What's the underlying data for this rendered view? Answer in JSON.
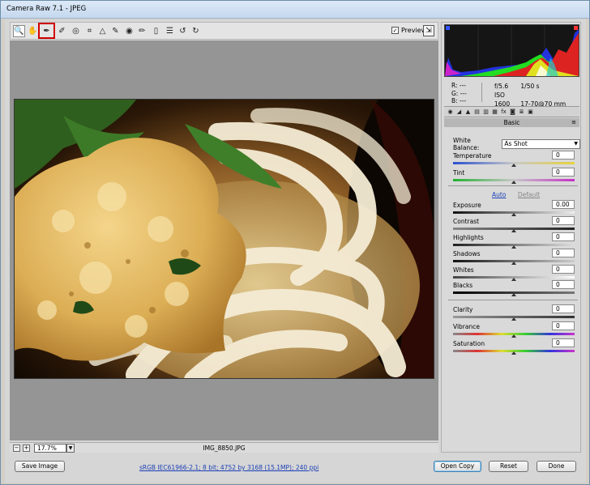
{
  "window": {
    "title": "Camera Raw 7.1  -  JPEG"
  },
  "toolbar": {
    "tools": [
      {
        "name": "zoom-tool",
        "glyph": "🔍"
      },
      {
        "name": "hand-tool",
        "glyph": "✋"
      },
      {
        "name": "white-balance-tool",
        "glyph": "✒"
      },
      {
        "name": "color-sampler-tool",
        "glyph": "✐"
      },
      {
        "name": "targeted-adjustment-tool",
        "glyph": "◎"
      },
      {
        "name": "crop-tool",
        "glyph": "⌗"
      },
      {
        "name": "straighten-tool",
        "glyph": "△"
      },
      {
        "name": "spot-removal-tool",
        "glyph": "✎"
      },
      {
        "name": "red-eye-tool",
        "glyph": "◉"
      },
      {
        "name": "adjustment-brush-tool",
        "glyph": "✏"
      },
      {
        "name": "graduated-filter-tool",
        "glyph": "▯"
      },
      {
        "name": "preferences-tool",
        "glyph": "☰"
      },
      {
        "name": "rotate-ccw-tool",
        "glyph": "↺"
      },
      {
        "name": "rotate-cw-tool",
        "glyph": "↻"
      }
    ],
    "preview_label": "Preview",
    "preview_checked": "✓"
  },
  "status": {
    "zoom_minus": "−",
    "zoom_plus": "+",
    "zoom": "17.7%",
    "zoom_arrow": "▼",
    "filename": "IMG_8850.JPG"
  },
  "readout": {
    "r": "R:  ---",
    "g": "G:  ---",
    "b": "B:  ---",
    "aperture": "f/5.6",
    "shutter": "1/50 s",
    "iso": "ISO 1600",
    "lens": "17-70@70 mm"
  },
  "panel": {
    "section": "Basic",
    "menu_glyph": "≡",
    "white_balance_label": "White Balance:",
    "white_balance_value": "As Shot",
    "auto_label": "Auto",
    "default_label": "Default",
    "controls": {
      "temperature": {
        "label": "Temperature",
        "value": "0"
      },
      "tint": {
        "label": "Tint",
        "value": "0"
      },
      "exposure": {
        "label": "Exposure",
        "value": "0.00"
      },
      "contrast": {
        "label": "Contrast",
        "value": "0"
      },
      "highlights": {
        "label": "Highlights",
        "value": "0"
      },
      "shadows": {
        "label": "Shadows",
        "value": "0"
      },
      "whites": {
        "label": "Whites",
        "value": "0"
      },
      "blacks": {
        "label": "Blacks",
        "value": "0"
      },
      "clarity": {
        "label": "Clarity",
        "value": "0"
      },
      "vibrance": {
        "label": "Vibrance",
        "value": "0"
      },
      "saturation": {
        "label": "Saturation",
        "value": "0"
      }
    }
  },
  "footer": {
    "save_image": "Save Image",
    "workflow_link": "sRGB IEC61966-2.1; 8 bit; 4752 by 3168 (15.1MP); 240 ppi",
    "open_copy": "Open Copy",
    "reset": "Reset",
    "done": "Done"
  },
  "colors": {
    "accent_link": "#1a3fb5",
    "highlight_border": "#d10000"
  }
}
